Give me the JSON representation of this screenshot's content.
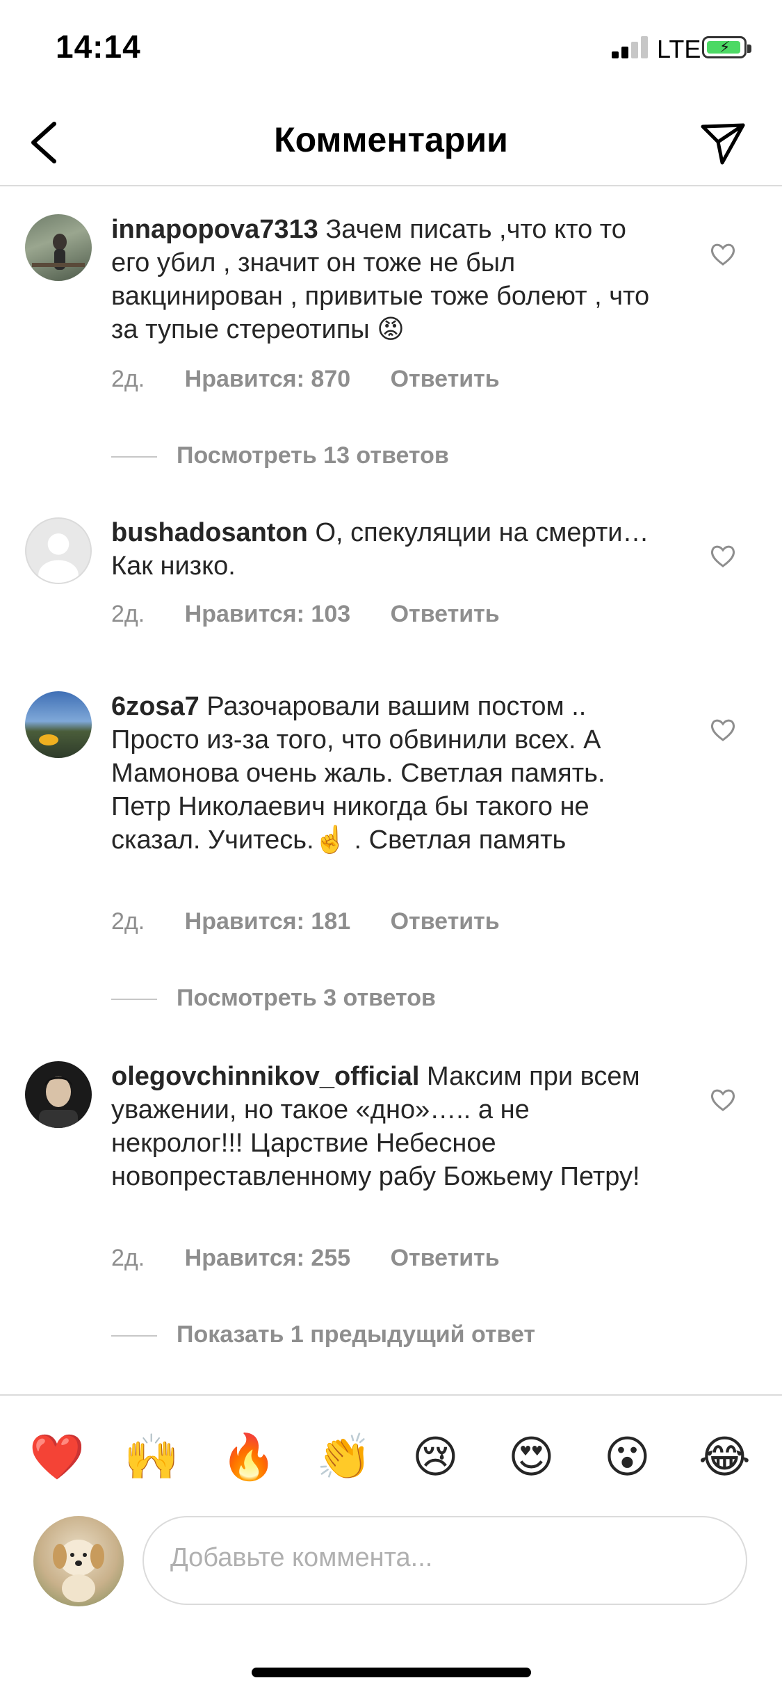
{
  "status": {
    "time": "14:14",
    "network": "LTE"
  },
  "header": {
    "title": "Комментарии"
  },
  "comments": [
    {
      "user": "innapopova7313",
      "text": "Зачем писать ,что кто то его убил , значит он тоже не был вакцинирован , привитые тоже болеют , что за тупые стереотипы 😡",
      "age": "2д.",
      "likes": "Нравится: 870",
      "reply": "Ответить",
      "replies": "Посмотреть 13 ответов"
    },
    {
      "user": "bushadosanton",
      "text": "О, спекуляции на смерти… Как низко.",
      "age": "2д.",
      "likes": "Нравится: 103",
      "reply": "Ответить"
    },
    {
      "user": "6zosa7",
      "text": "Разочаровали вашим постом .. Просто из-за того, что обвинили всех. А Мамонова очень жаль. Светлая память. Петр Николаевич никогда бы такого не сказал. Учитесь.☝️ . Светлая память",
      "age": "2д.",
      "likes": "Нравится: 181",
      "reply": "Ответить",
      "replies": "Посмотреть 3 ответов"
    },
    {
      "user": "olegovchinnikov_official",
      "text": "Максим при всем уважении, но такое «дно»….. а не некролог!!! Царствие Небесное новопреставленному рабу Божьему Петру!",
      "age": "2д.",
      "likes": "Нравится: 255",
      "reply": "Ответить",
      "replies": "Показать 1 предыдущий ответ"
    }
  ],
  "reactions": [
    "❤️",
    "🙌",
    "🔥",
    "👏",
    "😢",
    "😍",
    "😮",
    "😂"
  ],
  "composer": {
    "placeholder": "Добавьте коммента..."
  },
  "colors": {
    "text": "#262626",
    "muted": "#8e8e8e",
    "divider": "#dbdbdb",
    "battery": "#4cd964"
  }
}
